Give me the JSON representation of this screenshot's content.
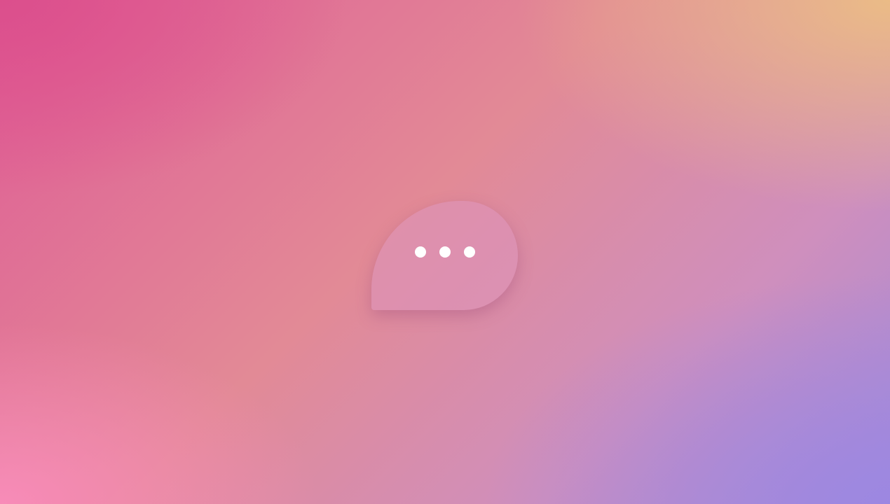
{
  "background": {
    "colors": {
      "top_left": "#dc4e8c",
      "top_right": "#ecbe84",
      "bottom_left": "#f98cba",
      "bottom_right": "#9c87e2"
    }
  },
  "typing_indicator": {
    "icon": "typing-bubble-icon",
    "dot_count": 3,
    "dot_color": "#ffffff",
    "bubble_color": "#dc96be"
  }
}
